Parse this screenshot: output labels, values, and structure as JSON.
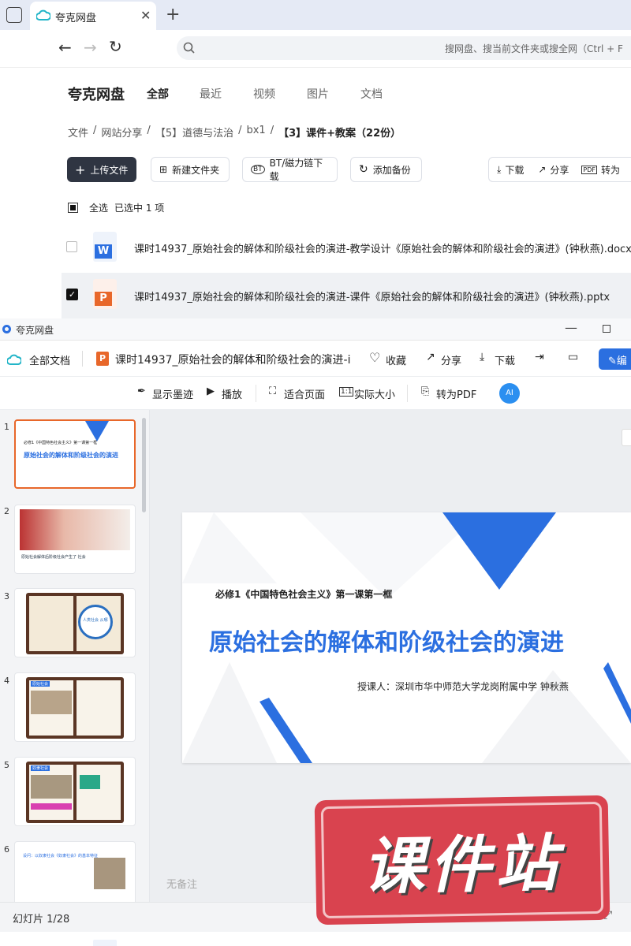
{
  "browser": {
    "tab_title": "夸克网盘",
    "address_placeholder": "搜网盘、搜当前文件夹或搜全网（Ctrl + F"
  },
  "app": {
    "brand": "夸克网盘",
    "nav": [
      "全部",
      "最近",
      "视频",
      "图片",
      "文档"
    ],
    "breadcrumb": [
      "文件",
      "网站分享",
      "【5】道德与法治",
      "bx1",
      "【3】课件+教案（22份）"
    ],
    "sep": "/",
    "buttons": {
      "upload": "上传文件",
      "new_folder": "新建文件夹",
      "bt": "BT/磁力链下载",
      "backup": "添加备份",
      "download": "下载",
      "share": "分享",
      "convert": "转为"
    },
    "select_all": "全选",
    "selected_text": "已选中 1 项",
    "files": [
      {
        "name": "课时14937_原始社会的解体和阶级社会的演进-教学设计《原始社会的解体和阶级社会的演进》(钟秋燕).docx",
        "type": "docx"
      },
      {
        "name": "课时14937_原始社会的解体和阶级社会的演进-课件《原始社会的解体和阶级社会的演进》(钟秋燕).pptx",
        "type": "pptx"
      }
    ]
  },
  "viewer": {
    "window_title": "夸克网盘",
    "all_docs": "全部文档",
    "doc_title": "课时14937_原始社会的解体和阶级社会的演进-i",
    "actions": {
      "favorite": "收藏",
      "share": "分享",
      "download": "下载",
      "edit": "编"
    },
    "toolbar": {
      "ink": "显示墨迹",
      "play": "播放",
      "fit": "适合页面",
      "actual": "实际大小",
      "pdf": "转为PDF",
      "ai": "AI"
    },
    "thumbs": [
      {
        "num": "1",
        "line1": "必修1《中国特色社会主义》第一课第一框",
        "line2": "原始社会的解体和阶级社会的演进"
      },
      {
        "num": "2",
        "caption": "原始社会解体后阶级社会产生了 社会"
      },
      {
        "num": "3",
        "badge": "人类社会 从哪"
      },
      {
        "num": "4",
        "tag": "原始社会"
      },
      {
        "num": "5",
        "tag": "奴隶社会"
      },
      {
        "num": "6",
        "text": "设问：以奴隶社会《奴隶社会》的基本特征"
      }
    ],
    "slide": {
      "subtitle": "必修1《中国特色社会主义》第一课第一框",
      "title": "原始社会的解体和阶级社会的演进",
      "author": "授课人：深圳市华中师范大学龙岗附属中学 钟秋燕"
    },
    "notes": "无备注",
    "status": "幻灯片 1/28",
    "watermark": "课件站"
  },
  "colors": {
    "accent": "#2b6fe0",
    "brand_dark": "#2f3542",
    "watermark": "#d9434f",
    "pptx": "#e8672a"
  }
}
